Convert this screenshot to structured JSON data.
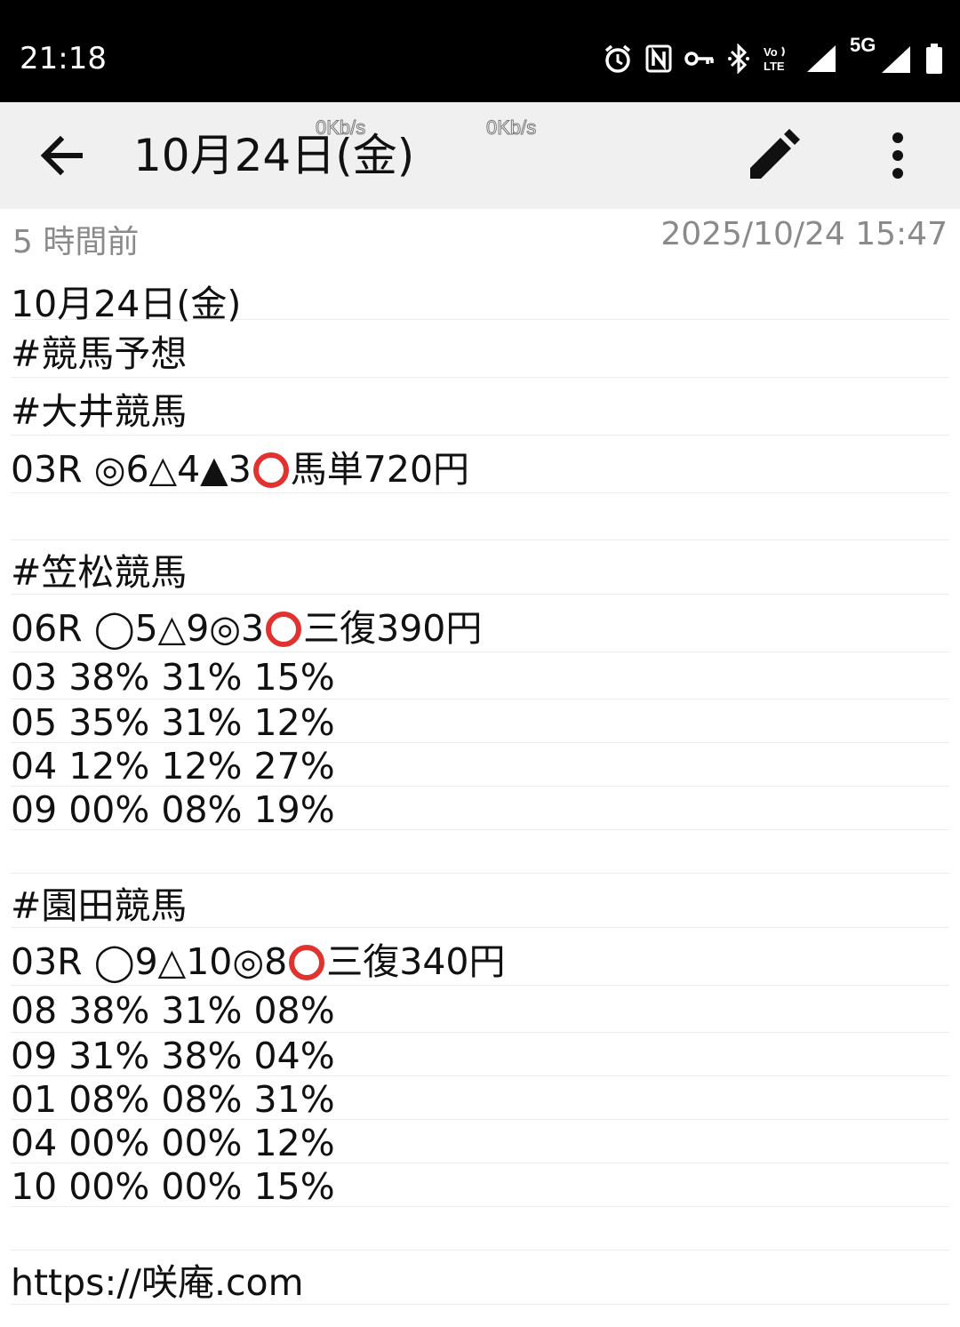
{
  "status_bar": {
    "time": "21:18",
    "icons": [
      "alarm-icon",
      "nfc-icon",
      "vpn-key-icon",
      "bluetooth-icon",
      "volte-icon",
      "signal-icon",
      "5g-signal-icon",
      "battery-icon"
    ],
    "network_label": "5G",
    "volte_label": "Vo LTE"
  },
  "app_bar": {
    "title": "10月24日(金)",
    "speed_1": "0Kb/s",
    "speed_2": "0Kb/s",
    "icons": [
      "back-arrow-icon",
      "edit-pencil-icon",
      "more-vert-icon"
    ]
  },
  "meta": {
    "relative_time": "5 時間前",
    "timestamp": "2025/10/24 15:47"
  },
  "note": {
    "title_line": "10月24日(金)",
    "tag_prediction": "#競馬予想",
    "ooi": {
      "tag": "#大井競馬",
      "race_pre": "03R ◎6△4▲3",
      "race_post": "馬単720円"
    },
    "kasamatsu": {
      "tag": "#笠松競馬",
      "race_pre": "06R ◯5△9◎3",
      "race_post": "三復390円",
      "rows": [
        "03 38% 31% 15%",
        "05 35% 31% 12%",
        "04 12% 12% 27%",
        "09 00% 08% 19%"
      ]
    },
    "sonoda": {
      "tag": "#園田競馬",
      "race_pre": "03R ◯9△10◎8",
      "race_post": "三復340円",
      "rows": [
        "08 38% 31% 08%",
        "09 31% 38% 04%",
        "01 08% 08% 31%",
        "04 00% 00% 12%",
        "10 00% 00% 15%"
      ]
    },
    "link": "https://咲庵.com"
  },
  "colors": {
    "accent_ring": "#e0322f",
    "app_bar_bg": "#f0f0f0",
    "meta_text": "#8a8a8a"
  }
}
